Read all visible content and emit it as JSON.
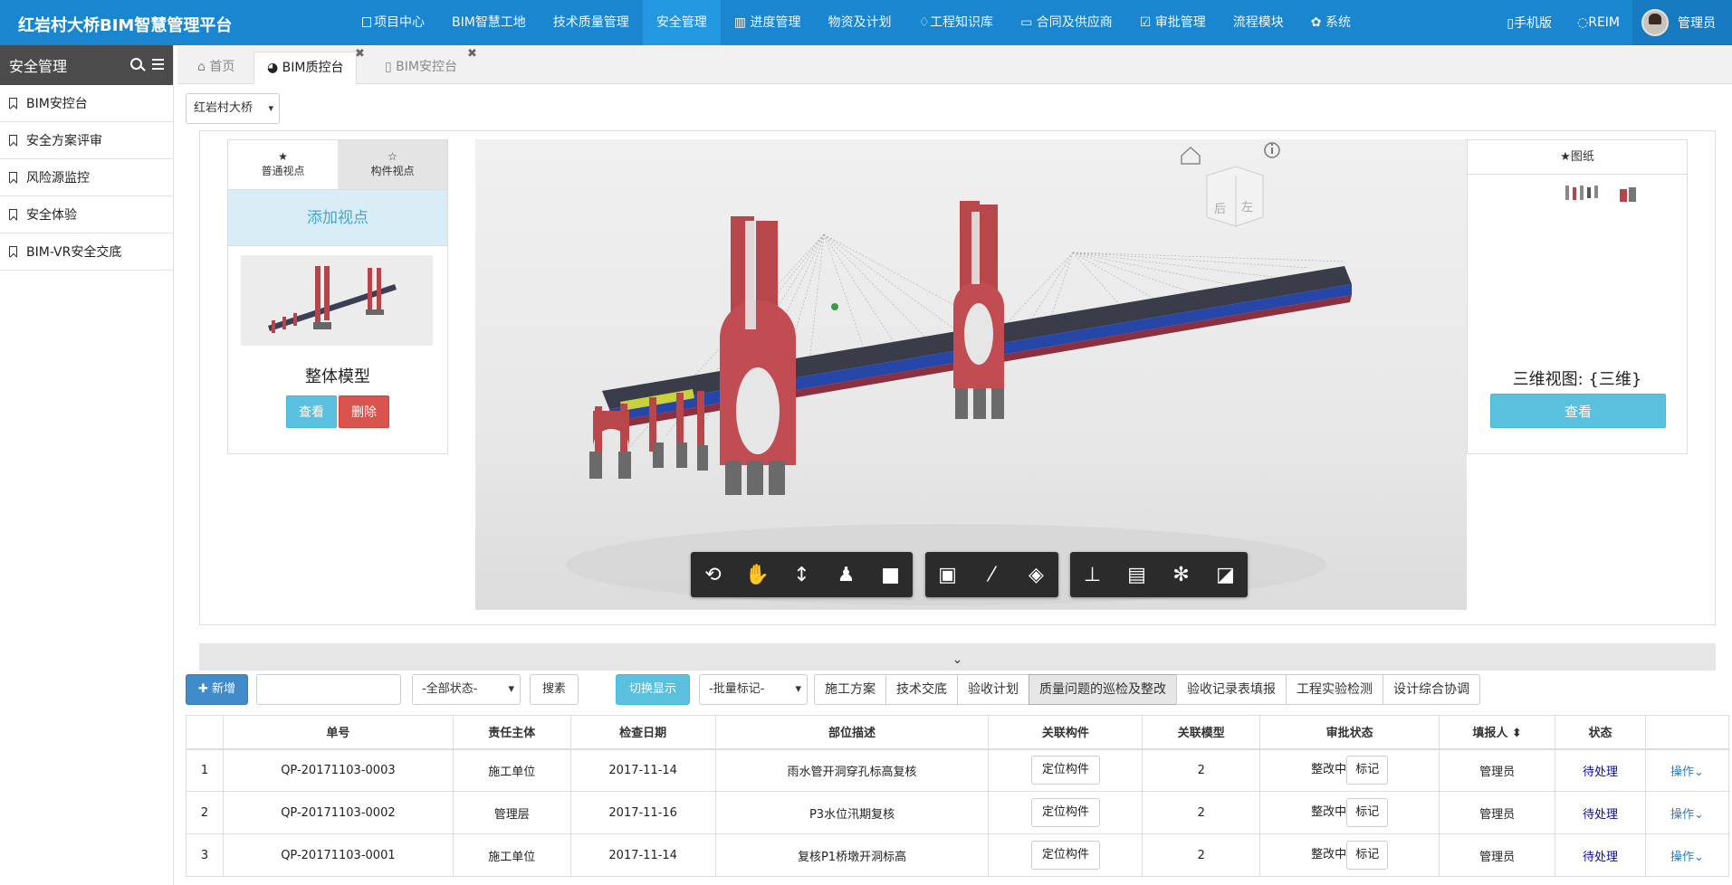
{
  "app": {
    "title": "红岩村大桥BIM智慧管理平台"
  },
  "topnav": {
    "items": [
      {
        "label": "项目中心",
        "icon": "file-icon",
        "active": false
      },
      {
        "label": "BIM智慧工地",
        "icon": "",
        "active": false
      },
      {
        "label": "技术质量管理",
        "icon": "",
        "active": false
      },
      {
        "label": "安全管理",
        "icon": "",
        "active": true
      },
      {
        "label": "进度管理",
        "icon": "chart-icon",
        "active": false
      },
      {
        "label": "物资及计划",
        "icon": "",
        "active": false
      },
      {
        "label": "工程知识库",
        "icon": "bulb-icon",
        "active": false
      },
      {
        "label": "合同及供应商",
        "icon": "card-icon",
        "active": false
      },
      {
        "label": "审批管理",
        "icon": "check-icon",
        "active": false
      },
      {
        "label": "流程模块",
        "icon": "",
        "active": false
      },
      {
        "label": "系统",
        "icon": "gear-icon",
        "active": false
      }
    ],
    "mobile": "手机版",
    "reim": "REIM",
    "user": "管理员"
  },
  "sidebar": {
    "title": "安全管理",
    "items": [
      {
        "label": "BIM安控台"
      },
      {
        "label": "安全方案评审"
      },
      {
        "label": "风险源监控"
      },
      {
        "label": "安全体验"
      },
      {
        "label": "BIM-VR安全交底"
      }
    ]
  },
  "tabs": [
    {
      "label": "首页"
    },
    {
      "label": "BIM质控台"
    },
    {
      "label": "BIM安控台"
    }
  ],
  "project_select": {
    "value": "红岩村大桥"
  },
  "viewpoint": {
    "tab_normal": "普通视点",
    "tab_component": "构件视点",
    "add": "添加视点",
    "name": "整体模型",
    "view": "查看",
    "delete": "删除"
  },
  "viewer": {
    "cube_back": "后",
    "cube_left": "左"
  },
  "drawings": {
    "title": "★图纸",
    "name": "三维视图: {三维}",
    "view": "查看"
  },
  "toolbar": {
    "add": "新增",
    "status_select": "-全部状态-",
    "search": "搜素",
    "switch": "切换显示",
    "batch_select": "-批量标记-",
    "filters": [
      {
        "label": "施工方案",
        "active": false
      },
      {
        "label": "技术交底",
        "active": false
      },
      {
        "label": "验收计划",
        "active": false
      },
      {
        "label": "质量问题的巡检及整改",
        "active": true
      },
      {
        "label": "验收记录表填报",
        "active": false
      },
      {
        "label": "工程实验检测",
        "active": false
      },
      {
        "label": "设计综合协调",
        "active": false
      }
    ]
  },
  "table": {
    "headers": [
      "",
      "单号",
      "责任主体",
      "检查日期",
      "部位描述",
      "关联构件",
      "关联模型",
      "审批状态",
      "填报人",
      "状态",
      ""
    ],
    "rows": [
      {
        "idx": "1",
        "no": "QP-20171103-0003",
        "party": "施工单位",
        "date": "2017-11-14",
        "desc": "雨水管开洞穿孔标高复核",
        "locate": "定位构件",
        "model": "2",
        "approval": "整改中",
        "mark": "标记",
        "reporter": "管理员",
        "status": "待处理",
        "op": "操作"
      },
      {
        "idx": "2",
        "no": "QP-20171103-0002",
        "party": "管理层",
        "date": "2017-11-16",
        "desc": "P3水位汛期复核",
        "locate": "定位构件",
        "model": "2",
        "approval": "整改中",
        "mark": "标记",
        "reporter": "管理员",
        "status": "待处理",
        "op": "操作"
      },
      {
        "idx": "3",
        "no": "QP-20171103-0001",
        "party": "施工单位",
        "date": "2017-11-14",
        "desc": "复核P1桥墩开洞标高",
        "locate": "定位构件",
        "model": "2",
        "approval": "整改中",
        "mark": "标记",
        "reporter": "管理员",
        "status": "待处理",
        "op": "操作"
      }
    ]
  }
}
